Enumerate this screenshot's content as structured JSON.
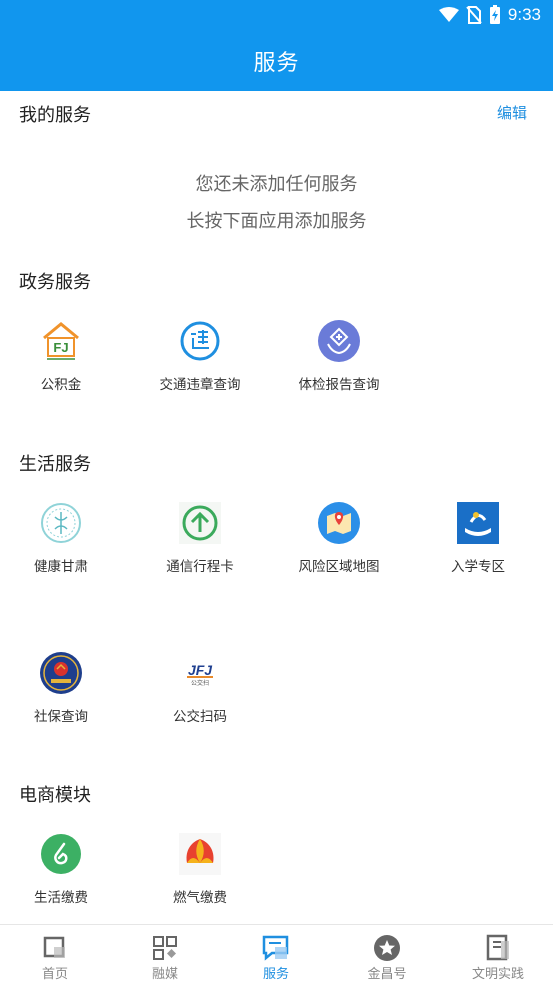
{
  "status_bar": {
    "time": "9:33"
  },
  "header": {
    "title": "服务"
  },
  "my_services": {
    "title": "我的服务",
    "edit_label": "编辑",
    "empty_line_1": "您还未添加任何服务",
    "empty_line_2": "长按下面应用添加服务"
  },
  "gov_services": {
    "title": "政务服务",
    "items": [
      {
        "label": "公积金",
        "icon": "housing-fund-icon"
      },
      {
        "label": "交通违章查询",
        "icon": "traffic-violation-icon"
      },
      {
        "label": "体检报告查询",
        "icon": "health-report-icon"
      }
    ]
  },
  "life_services": {
    "title": "生活服务",
    "items": [
      {
        "label": "健康甘肃",
        "icon": "health-gansu-icon"
      },
      {
        "label": "通信行程卡",
        "icon": "travel-card-icon"
      },
      {
        "label": "风险区域地图",
        "icon": "risk-map-icon"
      },
      {
        "label": "入学专区",
        "icon": "enrollment-icon"
      },
      {
        "label": "社保查询",
        "icon": "social-security-icon"
      },
      {
        "label": "公交扫码",
        "icon": "bus-scan-icon",
        "logo_text": "JFJ",
        "logo_subtext": "公交扫"
      }
    ]
  },
  "ecommerce": {
    "title": "电商模块",
    "items": [
      {
        "label": "生活缴费",
        "icon": "utility-payment-icon"
      },
      {
        "label": "燃气缴费",
        "icon": "gas-payment-icon"
      }
    ]
  },
  "bottom_nav": {
    "active": "服务",
    "items": [
      {
        "label": "首页",
        "icon": "home-icon"
      },
      {
        "label": "融媒",
        "icon": "media-grid-icon"
      },
      {
        "label": "服务",
        "icon": "service-icon"
      },
      {
        "label": "金昌号",
        "icon": "star-badge-icon"
      },
      {
        "label": "文明实践",
        "icon": "document-icon"
      }
    ]
  },
  "colors": {
    "brand": "#1196EE",
    "accent_text": "#1F8FE0"
  }
}
